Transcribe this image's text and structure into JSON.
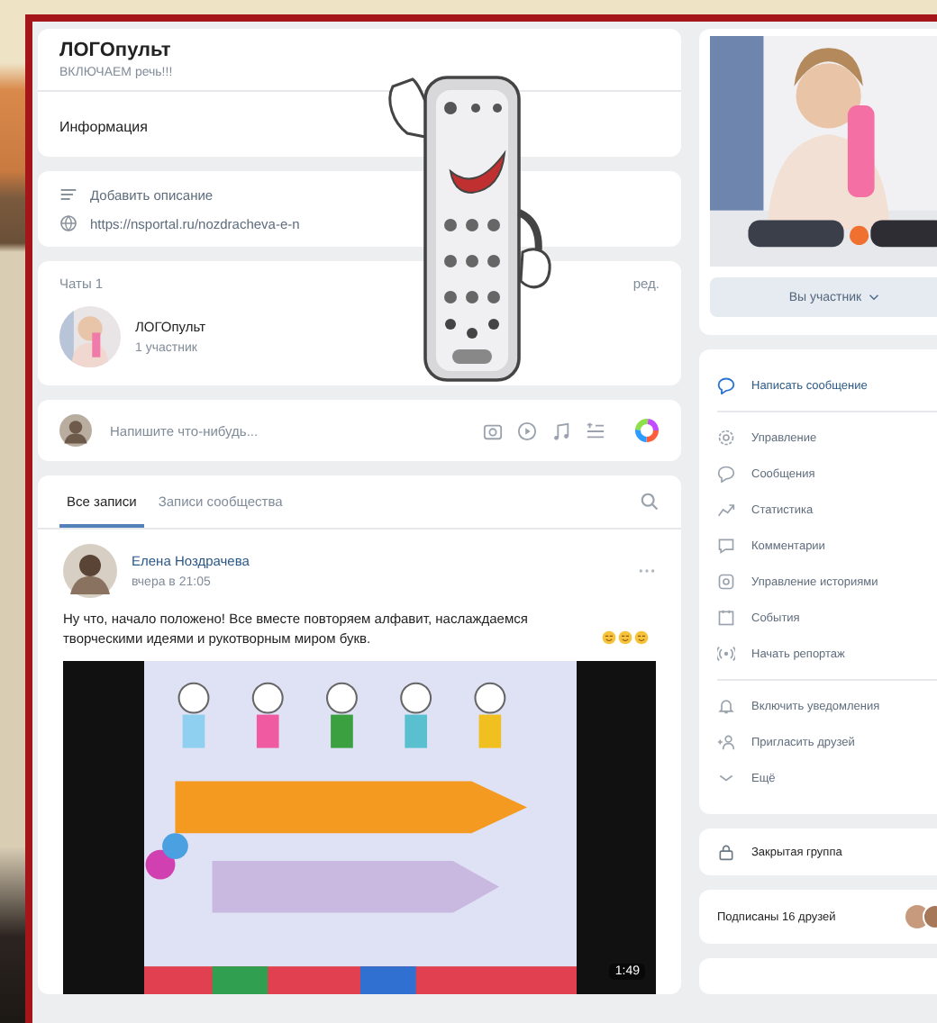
{
  "group": {
    "name": "ЛОГОпульт",
    "status": "ВКЛЮЧАЕМ речь!!!",
    "info_tab": "Информация",
    "links": [
      {
        "kind": "description",
        "text": "Добавить описание"
      },
      {
        "kind": "link",
        "text": "https://nsportal.ru/nozdracheva-e-n"
      }
    ]
  },
  "chats": {
    "title": "Чаты",
    "count": "1",
    "edit": "ред.",
    "items": [
      {
        "name": "ЛОГОпульт",
        "members": "1 участник"
      }
    ]
  },
  "composer": {
    "placeholder": "Напишите что-нибудь..."
  },
  "wall": {
    "tabs": [
      {
        "label": "Все записи",
        "selected": true
      },
      {
        "label": "Записи сообщества",
        "selected": false
      }
    ],
    "post": {
      "author": "Елена Ноздрачева",
      "time": "вчера в 21:05",
      "text": "Ну что, начало положено! Все вместе повторяем алфавит, наслаждаемся творческими идеями и рукотворным миром букв.",
      "video": {
        "duration": "1:49"
      }
    }
  },
  "sidebar": {
    "member_button": "Вы участник",
    "sections": [
      {
        "items": [
          {
            "kind": "message",
            "label": "Написать сообщение"
          }
        ]
      },
      {
        "items": [
          {
            "kind": "manage",
            "label": "Управление"
          },
          {
            "kind": "messages",
            "label": "Сообщения"
          },
          {
            "kind": "stats",
            "label": "Статистика"
          },
          {
            "kind": "comments",
            "label": "Комментарии"
          },
          {
            "kind": "stories",
            "label": "Управление историями"
          },
          {
            "kind": "events",
            "label": "События"
          },
          {
            "kind": "live",
            "label": "Начать репортаж"
          }
        ]
      },
      {
        "items": [
          {
            "kind": "notify",
            "label": "Включить уведомления"
          },
          {
            "kind": "invite",
            "label": "Пригласить друзей"
          },
          {
            "kind": "more",
            "label": "Ещё"
          }
        ]
      }
    ],
    "privacy": "Закрытая группа",
    "friends": "Подписаны 16 друзей"
  }
}
